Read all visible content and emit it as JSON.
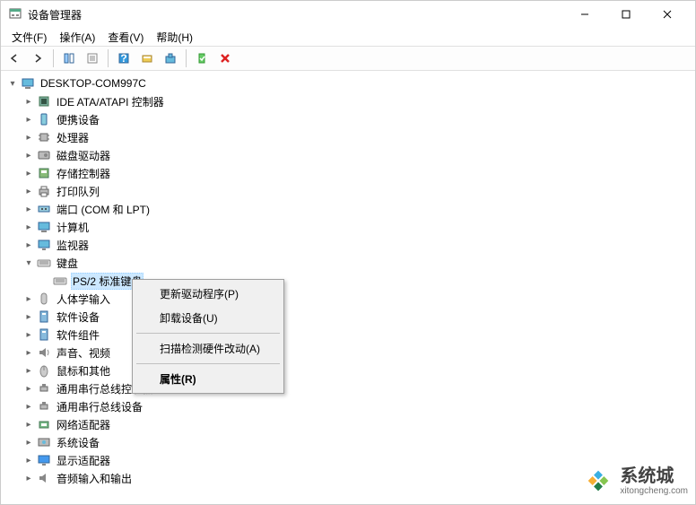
{
  "window": {
    "title": "设备管理器"
  },
  "menu": {
    "file": "文件(F)",
    "action": "操作(A)",
    "view": "查看(V)",
    "help": "帮助(H)"
  },
  "root": {
    "name": "DESKTOP-COM997C"
  },
  "nodes": [
    {
      "label": "IDE ATA/ATAPI 控制器",
      "icon": "chip"
    },
    {
      "label": "便携设备",
      "icon": "portable"
    },
    {
      "label": "处理器",
      "icon": "cpu"
    },
    {
      "label": "磁盘驱动器",
      "icon": "disk"
    },
    {
      "label": "存储控制器",
      "icon": "storage"
    },
    {
      "label": "打印队列",
      "icon": "printer"
    },
    {
      "label": "端口 (COM 和 LPT)",
      "icon": "port"
    },
    {
      "label": "计算机",
      "icon": "computer"
    },
    {
      "label": "监视器",
      "icon": "monitor"
    },
    {
      "label": "键盘",
      "icon": "keyboard",
      "expanded": true,
      "children": [
        {
          "label": "PS/2 标准键盘",
          "icon": "keyboard",
          "selected": true
        }
      ]
    },
    {
      "label": "人体学输入",
      "icon": "hid",
      "truncated": true
    },
    {
      "label": "软件设备",
      "icon": "soft"
    },
    {
      "label": "软件组件",
      "icon": "soft"
    },
    {
      "label": "声音、视频",
      "icon": "sound",
      "truncated": true
    },
    {
      "label": "鼠标和其他",
      "icon": "mouse",
      "truncated": true
    },
    {
      "label": "通用串行总线控制器",
      "icon": "usb"
    },
    {
      "label": "通用串行总线设备",
      "icon": "usb"
    },
    {
      "label": "网络适配器",
      "icon": "network"
    },
    {
      "label": "系统设备",
      "icon": "system"
    },
    {
      "label": "显示适配器",
      "icon": "display"
    },
    {
      "label": "音频输入和输出",
      "icon": "audio"
    }
  ],
  "contextMenu": {
    "update": "更新驱动程序(P)",
    "uninstall": "卸载设备(U)",
    "scan": "扫描检测硬件改动(A)",
    "properties": "属性(R)"
  },
  "watermark": {
    "name": "系统城",
    "url": "xitongcheng.com"
  }
}
